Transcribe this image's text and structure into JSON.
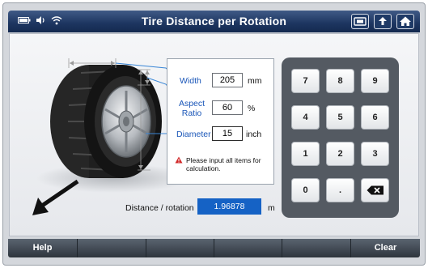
{
  "title": "Tire Distance per Rotation",
  "status_icons": [
    "battery-icon",
    "volume-icon",
    "wifi-icon"
  ],
  "toolbar_icons": [
    "screenshot-icon",
    "back-icon",
    "home-icon"
  ],
  "inputs": {
    "width": {
      "label": "Width",
      "value": "205",
      "unit": "mm"
    },
    "aspect": {
      "label_line1": "Aspect",
      "label_line2": "Ratio",
      "value": "60",
      "unit": "%"
    },
    "diameter": {
      "label": "Diameter",
      "value": "15",
      "unit": "inch"
    }
  },
  "warning": "Please input all items for calculation.",
  "result": {
    "label": "Distance / rotation",
    "value": "1.96878",
    "unit": "m"
  },
  "keypad": {
    "keys": [
      "7",
      "8",
      "9",
      "4",
      "5",
      "6",
      "1",
      "2",
      "3",
      "0",
      "."
    ],
    "backspace": "backspace-icon"
  },
  "bottom": {
    "help": "Help",
    "clear": "Clear"
  },
  "colors": {
    "accent": "#1562c5",
    "label": "#1a56b8",
    "titlebar": "#1d3560",
    "keypad_bg": "#545a62"
  }
}
